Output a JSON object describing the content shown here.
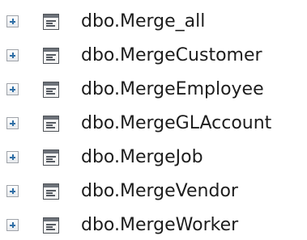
{
  "object_explorer": {
    "items": [
      {
        "label": "dbo.Merge_all",
        "icon": "table-icon",
        "expander": "plus-icon"
      },
      {
        "label": "dbo.MergeCustomer",
        "icon": "table-icon",
        "expander": "plus-icon"
      },
      {
        "label": "dbo.MergeEmployee",
        "icon": "table-icon",
        "expander": "plus-icon"
      },
      {
        "label": "dbo.MergeGLAccount",
        "icon": "table-icon",
        "expander": "plus-icon"
      },
      {
        "label": "dbo.MergeJob",
        "icon": "table-icon",
        "expander": "plus-icon"
      },
      {
        "label": "dbo.MergeVendor",
        "icon": "table-icon",
        "expander": "plus-icon"
      },
      {
        "label": "dbo.MergeWorker",
        "icon": "table-icon",
        "expander": "plus-icon"
      }
    ]
  }
}
